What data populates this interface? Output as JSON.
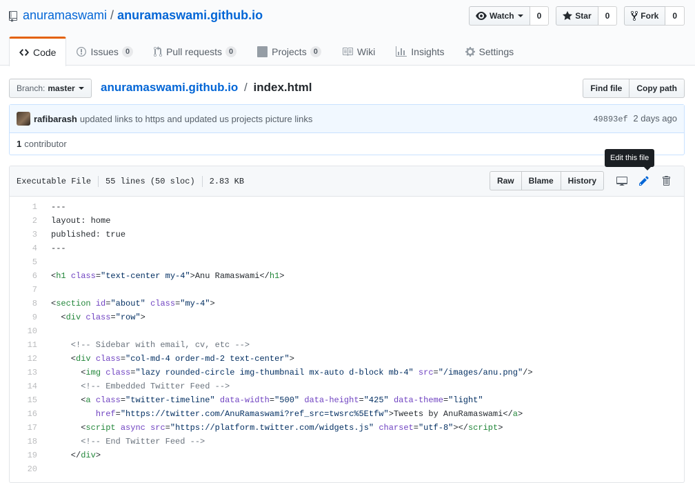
{
  "repo": {
    "owner": "anuramaswami",
    "separator": "/",
    "name": "anuramaswami.github.io"
  },
  "actions": [
    {
      "label": "Watch",
      "count": "0",
      "icon": "eye-icon",
      "has_caret": true
    },
    {
      "label": "Star",
      "count": "0",
      "icon": "star-icon"
    },
    {
      "label": "Fork",
      "count": "0",
      "icon": "fork-icon"
    }
  ],
  "tabs": [
    {
      "label": "Code",
      "icon": "code-icon",
      "selected": true
    },
    {
      "label": "Issues",
      "count": "0",
      "icon": "issue-icon"
    },
    {
      "label": "Pull requests",
      "count": "0",
      "icon": "pull-request-icon"
    },
    {
      "label": "Projects",
      "count": "0",
      "icon": "project-icon"
    },
    {
      "label": "Wiki",
      "icon": "book-icon"
    },
    {
      "label": "Insights",
      "icon": "graph-icon"
    },
    {
      "label": "Settings",
      "icon": "gear-icon"
    }
  ],
  "filenav": {
    "branch_prefix": "Branch:",
    "branch": "master",
    "breadcrumb_repo": "anuramaswami.github.io",
    "breadcrumb_sep": "/",
    "breadcrumb_file": "index.html",
    "find_file": "Find file",
    "copy_path": "Copy path"
  },
  "commit": {
    "author": "rafibarash",
    "message": "updated links to https and updated us projects picture links",
    "sha": "49893ef",
    "time": "2 days ago",
    "contributors_count": "1",
    "contributors_label": "contributor"
  },
  "file": {
    "mode": "Executable File",
    "lines": "55 lines (50 sloc)",
    "size": "2.83 KB",
    "raw": "Raw",
    "blame": "Blame",
    "history": "History",
    "tooltip": "Edit this file"
  },
  "code_lines": [
    [
      {
        "t": "---",
        "c": ""
      }
    ],
    [
      {
        "t": "layout: home",
        "c": ""
      }
    ],
    [
      {
        "t": "published: true",
        "c": ""
      }
    ],
    [
      {
        "t": "---",
        "c": ""
      }
    ],
    [],
    [
      {
        "t": "<",
        "c": ""
      },
      {
        "t": "h1",
        "c": "t-tag"
      },
      {
        "t": " ",
        "c": ""
      },
      {
        "t": "class",
        "c": "t-attr"
      },
      {
        "t": "=",
        "c": ""
      },
      {
        "t": "\"text-center my-4\"",
        "c": "t-str"
      },
      {
        "t": ">Anu Ramaswami</",
        "c": ""
      },
      {
        "t": "h1",
        "c": "t-tag"
      },
      {
        "t": ">",
        "c": ""
      }
    ],
    [],
    [
      {
        "t": "<",
        "c": ""
      },
      {
        "t": "section",
        "c": "t-tag"
      },
      {
        "t": " ",
        "c": ""
      },
      {
        "t": "id",
        "c": "t-attr"
      },
      {
        "t": "=",
        "c": ""
      },
      {
        "t": "\"about\"",
        "c": "t-str"
      },
      {
        "t": " ",
        "c": ""
      },
      {
        "t": "class",
        "c": "t-attr"
      },
      {
        "t": "=",
        "c": ""
      },
      {
        "t": "\"my-4\"",
        "c": "t-str"
      },
      {
        "t": ">",
        "c": ""
      }
    ],
    [
      {
        "t": "  <",
        "c": ""
      },
      {
        "t": "div",
        "c": "t-tag"
      },
      {
        "t": " ",
        "c": ""
      },
      {
        "t": "class",
        "c": "t-attr"
      },
      {
        "t": "=",
        "c": ""
      },
      {
        "t": "\"row\"",
        "c": "t-str"
      },
      {
        "t": ">",
        "c": ""
      }
    ],
    [],
    [
      {
        "t": "    <!-- Sidebar with email, cv, etc -->",
        "c": "t-cmt"
      }
    ],
    [
      {
        "t": "    <",
        "c": ""
      },
      {
        "t": "div",
        "c": "t-tag"
      },
      {
        "t": " ",
        "c": ""
      },
      {
        "t": "class",
        "c": "t-attr"
      },
      {
        "t": "=",
        "c": ""
      },
      {
        "t": "\"col-md-4 order-md-2 text-center\"",
        "c": "t-str"
      },
      {
        "t": ">",
        "c": ""
      }
    ],
    [
      {
        "t": "      <",
        "c": ""
      },
      {
        "t": "img",
        "c": "t-tag"
      },
      {
        "t": " ",
        "c": ""
      },
      {
        "t": "class",
        "c": "t-attr"
      },
      {
        "t": "=",
        "c": ""
      },
      {
        "t": "\"lazy rounded-circle img-thumbnail mx-auto d-block mb-4\"",
        "c": "t-str"
      },
      {
        "t": " ",
        "c": ""
      },
      {
        "t": "src",
        "c": "t-attr"
      },
      {
        "t": "=",
        "c": ""
      },
      {
        "t": "\"/images/anu.png\"",
        "c": "t-str"
      },
      {
        "t": "/>",
        "c": ""
      }
    ],
    [
      {
        "t": "      <!-- Embedded Twitter Feed -->",
        "c": "t-cmt"
      }
    ],
    [
      {
        "t": "      <",
        "c": ""
      },
      {
        "t": "a",
        "c": "t-tag"
      },
      {
        "t": " ",
        "c": ""
      },
      {
        "t": "class",
        "c": "t-attr"
      },
      {
        "t": "=",
        "c": ""
      },
      {
        "t": "\"twitter-timeline\"",
        "c": "t-str"
      },
      {
        "t": " ",
        "c": ""
      },
      {
        "t": "data-width",
        "c": "t-attr"
      },
      {
        "t": "=",
        "c": ""
      },
      {
        "t": "\"500\"",
        "c": "t-str"
      },
      {
        "t": " ",
        "c": ""
      },
      {
        "t": "data-height",
        "c": "t-attr"
      },
      {
        "t": "=",
        "c": ""
      },
      {
        "t": "\"425\"",
        "c": "t-str"
      },
      {
        "t": " ",
        "c": ""
      },
      {
        "t": "data-theme",
        "c": "t-attr"
      },
      {
        "t": "=",
        "c": ""
      },
      {
        "t": "\"light\"",
        "c": "t-str"
      }
    ],
    [
      {
        "t": "         ",
        "c": ""
      },
      {
        "t": "href",
        "c": "t-attr"
      },
      {
        "t": "=",
        "c": ""
      },
      {
        "t": "\"https://twitter.com/AnuRamaswami?ref_src=twsrc%5Etfw\"",
        "c": "t-str"
      },
      {
        "t": ">Tweets by AnuRamaswami</",
        "c": ""
      },
      {
        "t": "a",
        "c": "t-tag"
      },
      {
        "t": ">",
        "c": ""
      }
    ],
    [
      {
        "t": "      <",
        "c": ""
      },
      {
        "t": "script",
        "c": "t-tag"
      },
      {
        "t": " ",
        "c": ""
      },
      {
        "t": "async",
        "c": "t-attr"
      },
      {
        "t": " ",
        "c": ""
      },
      {
        "t": "src",
        "c": "t-attr"
      },
      {
        "t": "=",
        "c": ""
      },
      {
        "t": "\"https://platform.twitter.com/widgets.js\"",
        "c": "t-str"
      },
      {
        "t": " ",
        "c": ""
      },
      {
        "t": "charset",
        "c": "t-attr"
      },
      {
        "t": "=",
        "c": ""
      },
      {
        "t": "\"utf-8\"",
        "c": "t-str"
      },
      {
        "t": "></",
        "c": ""
      },
      {
        "t": "script",
        "c": "t-tag"
      },
      {
        "t": ">",
        "c": ""
      }
    ],
    [
      {
        "t": "      <!-- End Twitter Feed -->",
        "c": "t-cmt"
      }
    ],
    [
      {
        "t": "    </",
        "c": ""
      },
      {
        "t": "div",
        "c": "t-tag"
      },
      {
        "t": ">",
        "c": ""
      }
    ],
    []
  ]
}
